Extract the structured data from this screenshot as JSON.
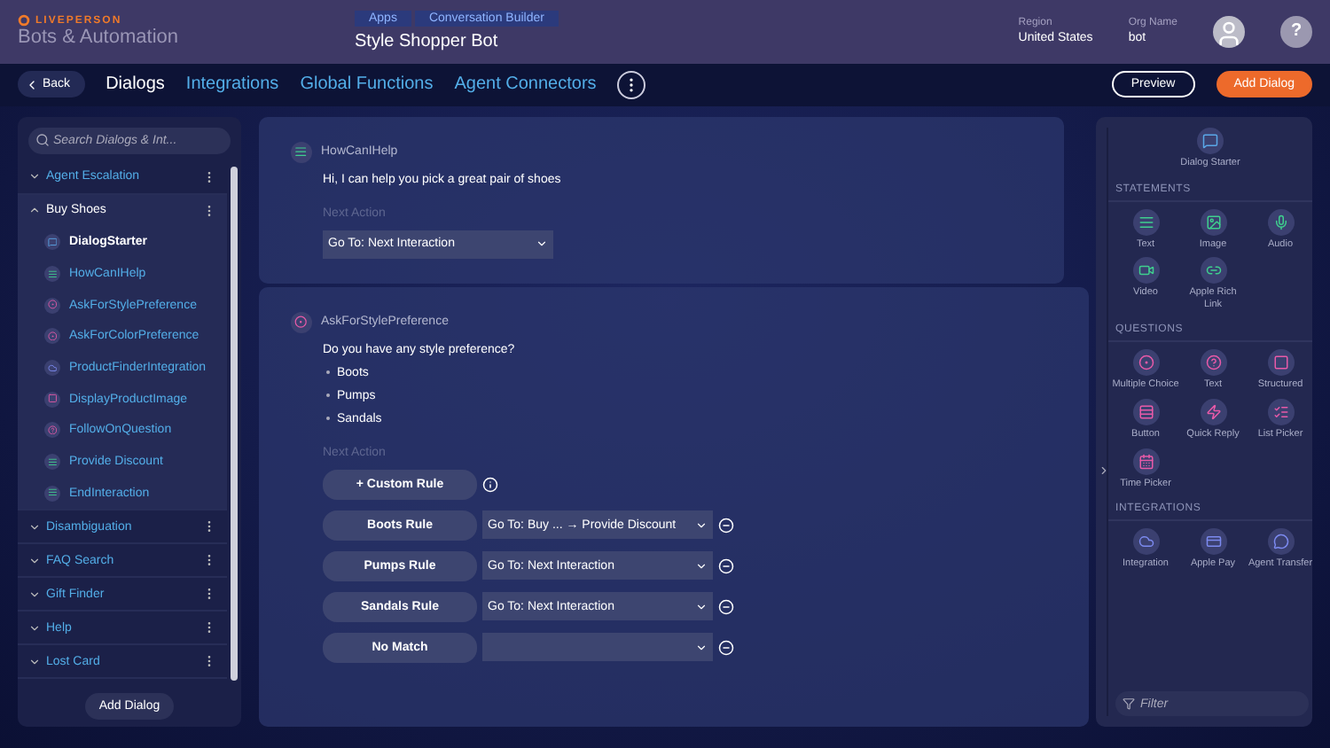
{
  "header": {
    "brand": "LIVEPERSON",
    "product": "Bots & Automation",
    "breadcrumbs": [
      "Apps",
      "Conversation Builder"
    ],
    "bot_name": "Style Shopper Bot",
    "region_label": "Region",
    "region": "United States",
    "org_label": "Org Name",
    "org": "bot",
    "help": "?"
  },
  "nav": {
    "back": "Back",
    "tabs": [
      {
        "label": "Dialogs",
        "selected": true
      },
      {
        "label": "Integrations",
        "selected": false
      },
      {
        "label": "Global Functions",
        "selected": false
      },
      {
        "label": "Agent Connectors",
        "selected": false
      }
    ],
    "preview": "Preview",
    "add_dialog": "Add Dialog"
  },
  "sidebar": {
    "search": {
      "placeholder": "Search Dialogs & Int..."
    },
    "dialogs": [
      {
        "name": "Agent Escalation",
        "expanded": false
      },
      {
        "name": "Buy Shoes",
        "expanded": true,
        "children": [
          {
            "name": "DialogStarter",
            "kind": "starter",
            "selected": true
          },
          {
            "name": "HowCanIHelp",
            "kind": "text",
            "selected": false
          },
          {
            "name": "AskForStylePreference",
            "kind": "choice",
            "selected": false
          },
          {
            "name": "AskForColorPreference",
            "kind": "choice",
            "selected": false
          },
          {
            "name": "ProductFinderIntegration",
            "kind": "integration",
            "selected": false
          },
          {
            "name": "DisplayProductImage",
            "kind": "structured",
            "selected": false
          },
          {
            "name": "FollowOnQuestion",
            "kind": "question",
            "selected": false
          },
          {
            "name": "Provide Discount",
            "kind": "text",
            "selected": false
          },
          {
            "name": "EndInteraction",
            "kind": "text",
            "selected": false
          }
        ]
      },
      {
        "name": "Disambiguation",
        "expanded": false
      },
      {
        "name": "FAQ Search",
        "expanded": false
      },
      {
        "name": "Gift Finder",
        "expanded": false
      },
      {
        "name": "Help",
        "expanded": false
      },
      {
        "name": "Lost Card",
        "expanded": false
      }
    ],
    "add_dialog": "Add Dialog"
  },
  "cards": [
    {
      "kind": "text",
      "title": "HowCanIHelp",
      "message": "Hi, I can help you pick a great pair of shoes",
      "next_action_label": "Next Action",
      "next_action": "Go To: Next Interaction"
    },
    {
      "kind": "choice",
      "title": "AskForStylePreference",
      "message": "Do you have any style preference?",
      "options": [
        "Boots",
        "Pumps",
        "Sandals"
      ],
      "next_action_label": "Next Action",
      "custom_rule": "+ Custom Rule",
      "rules": [
        {
          "label": "Boots Rule",
          "action": "Go To: Buy ... → Provide Discount"
        },
        {
          "label": "Pumps Rule",
          "action": "Go To: Next Interaction"
        },
        {
          "label": "Sandals Rule",
          "action": "Go To: Next Interaction"
        },
        {
          "label": "No Match"
        }
      ]
    }
  ],
  "palette": {
    "starter": "Dialog Starter",
    "sections": [
      {
        "title": "STATEMENTS",
        "items": [
          {
            "label": "Text",
            "kind": "text"
          },
          {
            "label": "Image",
            "kind": "image"
          },
          {
            "label": "Audio",
            "kind": "audio"
          },
          {
            "label": "Video",
            "kind": "video"
          },
          {
            "label": "Apple Rich Link",
            "kind": "link"
          }
        ]
      },
      {
        "title": "QUESTIONS",
        "items": [
          {
            "label": "Multiple Choice",
            "kind": "choice"
          },
          {
            "label": "Text",
            "kind": "question"
          },
          {
            "label": "Structured",
            "kind": "structured"
          },
          {
            "label": "Button",
            "kind": "buttons"
          },
          {
            "label": "Quick Reply",
            "kind": "quick"
          },
          {
            "label": "List Picker",
            "kind": "list"
          },
          {
            "label": "Time Picker",
            "kind": "time"
          }
        ]
      },
      {
        "title": "INTEGRATIONS",
        "items": [
          {
            "label": "Integration",
            "kind": "integration"
          },
          {
            "label": "Apple Pay",
            "kind": "pay"
          },
          {
            "label": "Agent Transfer",
            "kind": "transfer"
          }
        ]
      }
    ],
    "filter": {
      "placeholder": "Filter"
    }
  }
}
